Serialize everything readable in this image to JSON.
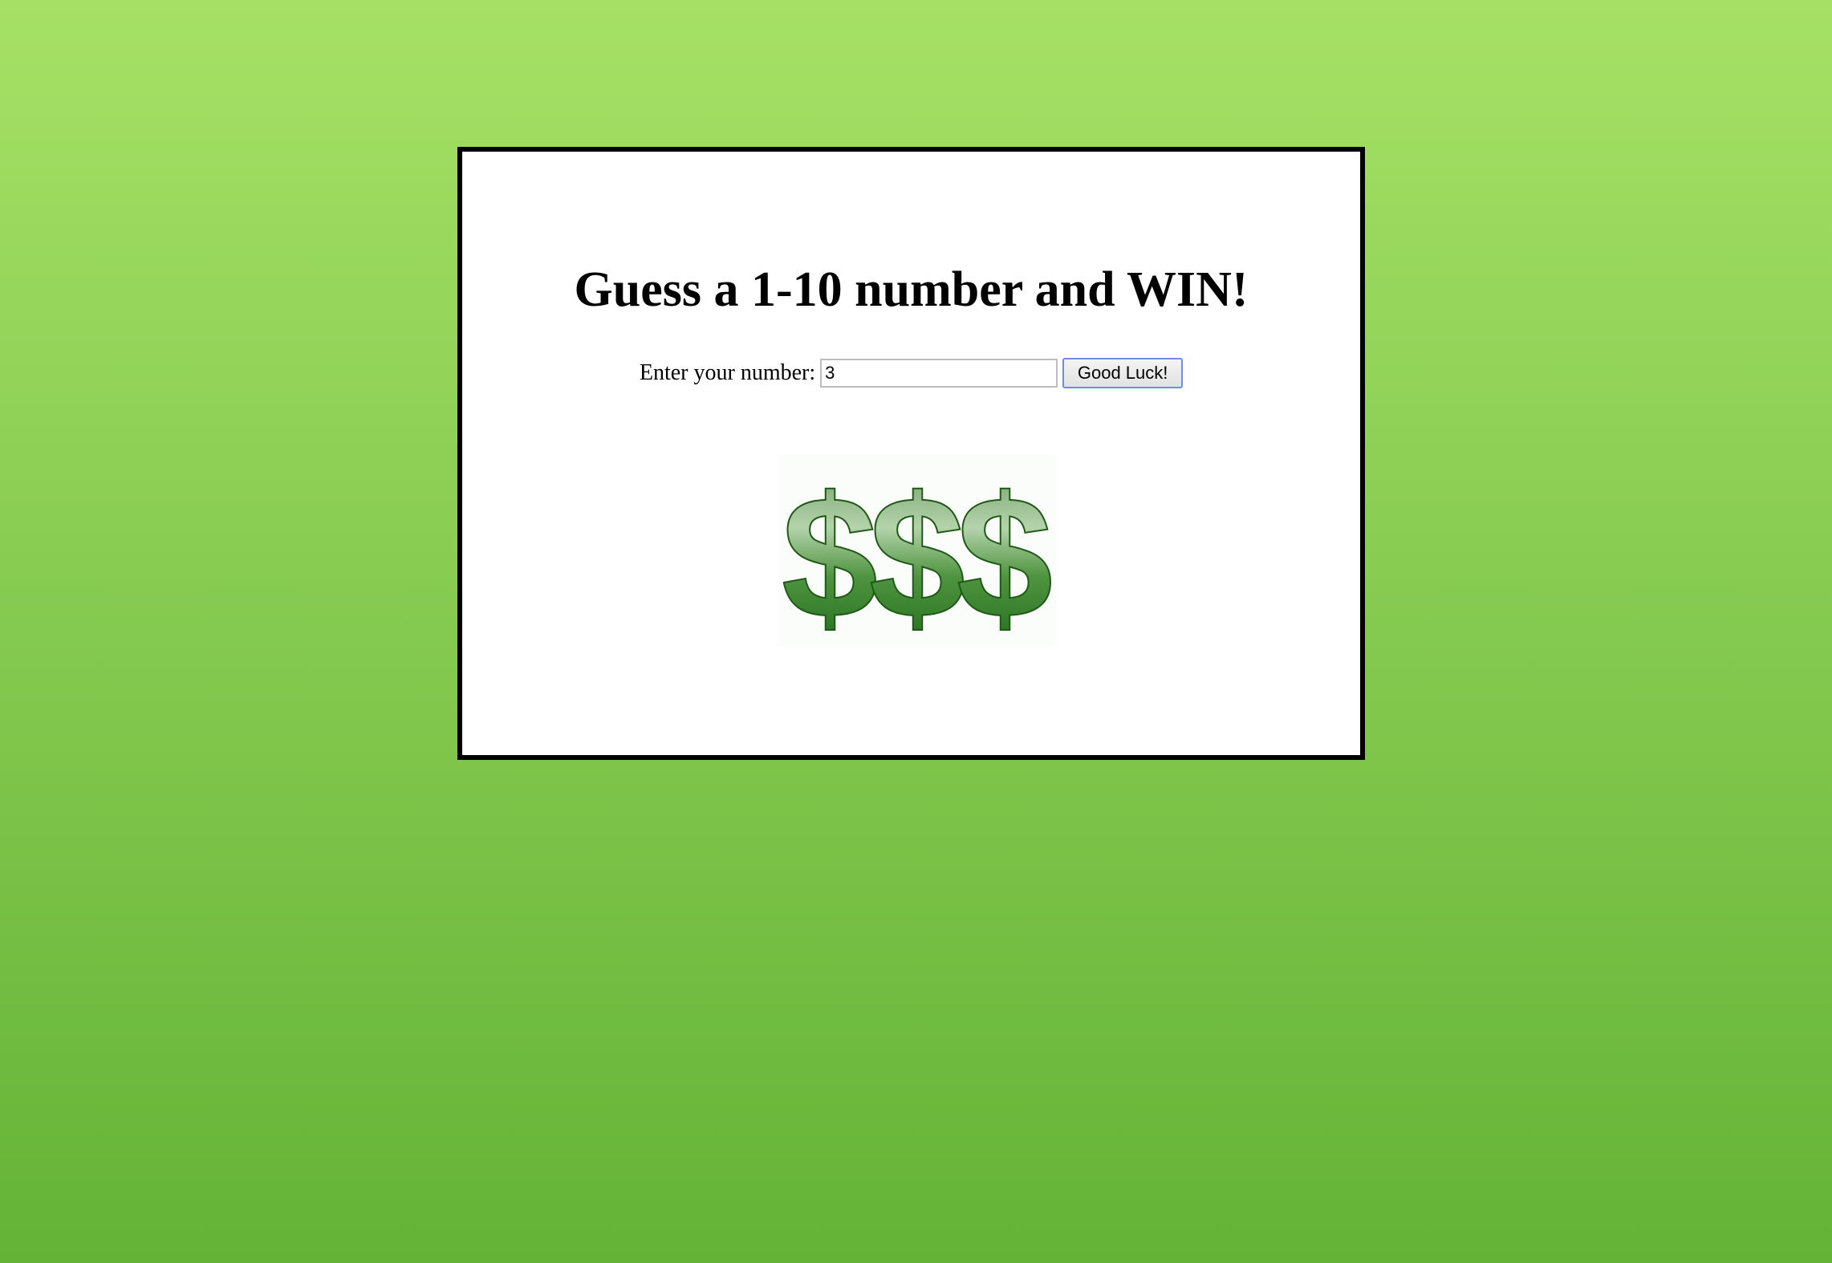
{
  "game": {
    "title": "Guess a 1-10 number and WIN!",
    "prompt_label": "Enter your number:",
    "number_value": "3",
    "submit_label": "Good Luck!"
  },
  "image": {
    "symbol": "$",
    "count": 3,
    "icon": "dollar-sign-icon"
  },
  "colors": {
    "background_top": "#a6e165",
    "background_bottom": "#64b336",
    "card_border": "#000000",
    "dollar_green": "#3f8f2f"
  }
}
